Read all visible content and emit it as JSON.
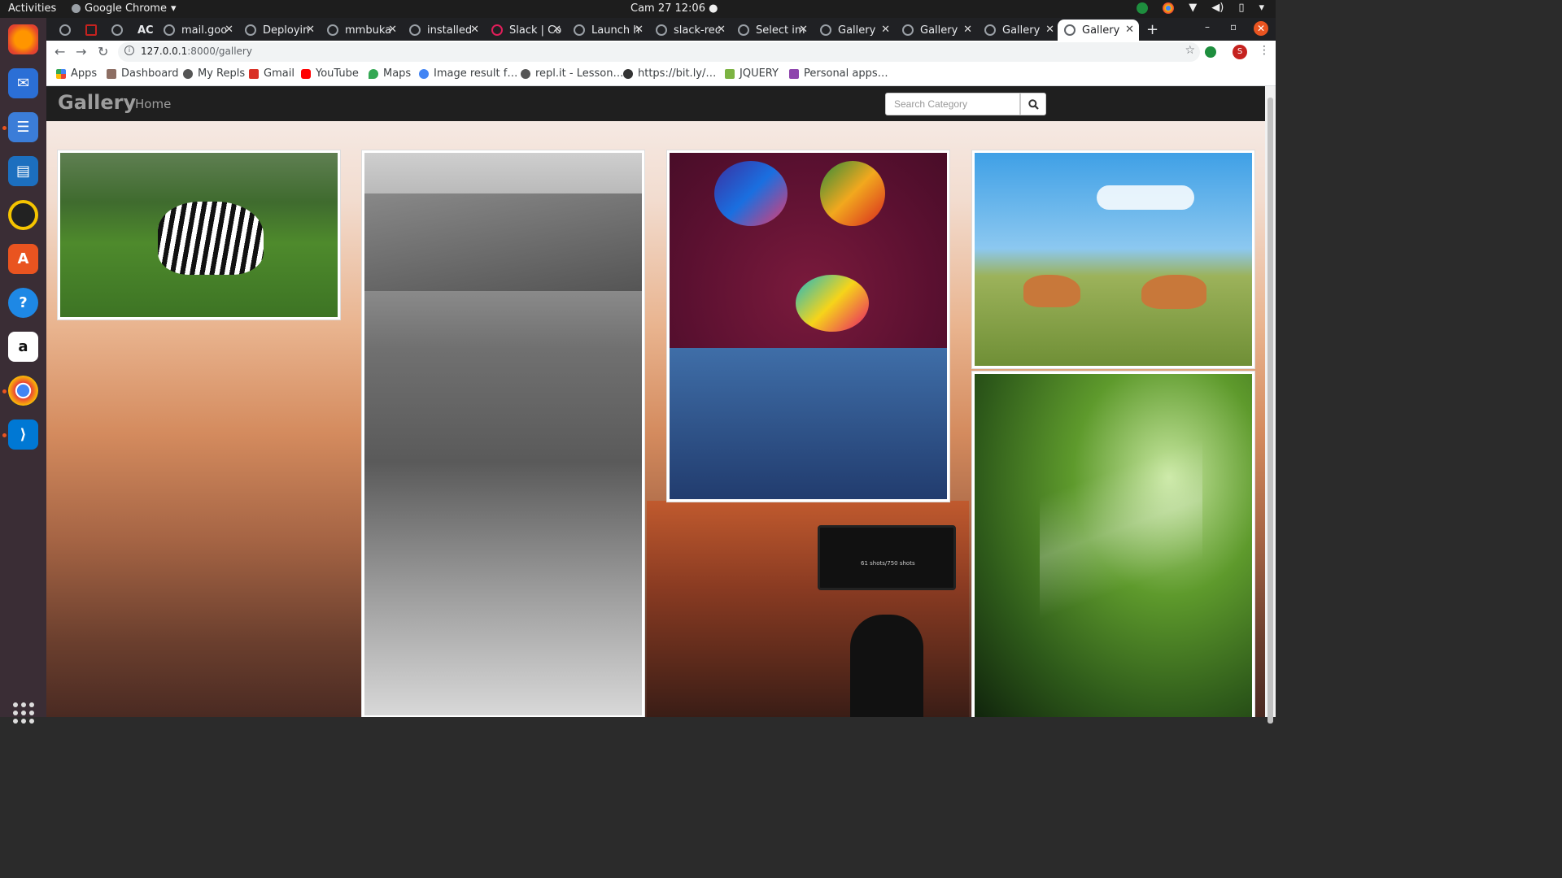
{
  "system": {
    "activities": "Activities",
    "app_name": "Google Chrome",
    "clock": "Cam 27  12:06 ●"
  },
  "tabs": [
    {
      "label": ""
    },
    {
      "label": ""
    },
    {
      "label": ""
    },
    {
      "label": "AC"
    },
    {
      "label": "mail.goo"
    },
    {
      "label": "Deployin"
    },
    {
      "label": "mmbuka"
    },
    {
      "label": "installed"
    },
    {
      "label": "Slack | Co"
    },
    {
      "label": "Launch h"
    },
    {
      "label": "slack-rec"
    },
    {
      "label": "Select im"
    },
    {
      "label": "Gallery"
    },
    {
      "label": "Gallery"
    },
    {
      "label": "Gallery"
    },
    {
      "label": "Gallery"
    }
  ],
  "address": {
    "host": "127.0.0.1",
    "path": ":8000/gallery"
  },
  "profile_initial": "S",
  "bookmarks": [
    {
      "label": "Apps",
      "color": "#4285f4"
    },
    {
      "label": "Dashboard",
      "color": "#8d6e63"
    },
    {
      "label": "My Repls",
      "color": "#555555"
    },
    {
      "label": "Gmail",
      "color": "#d93025"
    },
    {
      "label": "YouTube",
      "color": "#ff0000"
    },
    {
      "label": "Maps",
      "color": "#34a853"
    },
    {
      "label": "Image result f…",
      "color": "#4285f4"
    },
    {
      "label": "repl.it - Lesson…",
      "color": "#555555"
    },
    {
      "label": "https://bit.ly/…",
      "color": "#333333"
    },
    {
      "label": "JQUERY",
      "color": "#7cb342"
    },
    {
      "label": "Personal apps…",
      "color": "#8e44ad"
    }
  ],
  "site": {
    "brand": "Gallery",
    "nav_home": "Home",
    "search_placeholder": "Search Category"
  },
  "gallery": [
    {
      "name": "zebras"
    },
    {
      "name": "woman-portrait-bw"
    },
    {
      "name": "women-headwraps"
    },
    {
      "name": "antelopes"
    },
    {
      "name": "forest-sunbeams"
    }
  ],
  "camera_screen_text": "61 shots/750 shots"
}
